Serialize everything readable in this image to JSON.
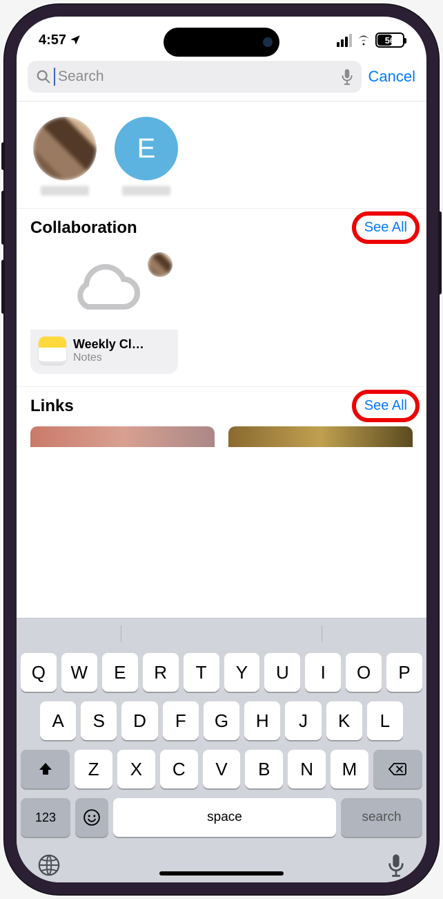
{
  "status": {
    "time": "4:57",
    "battery": "56"
  },
  "search": {
    "placeholder": "Search",
    "cancel": "Cancel"
  },
  "people": {
    "second_initial": "E"
  },
  "collaboration": {
    "heading": "Collaboration",
    "see_all": "See All",
    "card": {
      "title": "Weekly Cl…",
      "sub": "Notes"
    }
  },
  "links": {
    "heading": "Links",
    "see_all": "See All"
  },
  "keyboard": {
    "row1": [
      "Q",
      "W",
      "E",
      "R",
      "T",
      "Y",
      "U",
      "I",
      "O",
      "P"
    ],
    "row2": [
      "A",
      "S",
      "D",
      "F",
      "G",
      "H",
      "J",
      "K",
      "L"
    ],
    "row3": [
      "Z",
      "X",
      "C",
      "V",
      "B",
      "N",
      "M"
    ],
    "numkey": "123",
    "space": "space",
    "search": "search"
  }
}
